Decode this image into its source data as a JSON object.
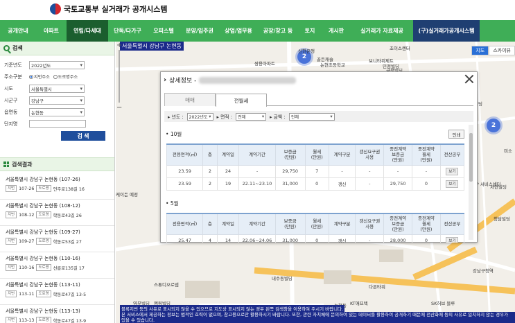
{
  "header": {
    "ministry": "국토교통부",
    "system": "실거래가 공개시스템"
  },
  "nav": [
    {
      "label": "공개안내",
      "width": 52
    },
    {
      "label": "아파트",
      "width": 44
    },
    {
      "label": "연립/다세대",
      "width": 60,
      "active": true
    },
    {
      "label": "단독/다가구",
      "width": 56
    },
    {
      "label": "오피스텔",
      "width": 48
    },
    {
      "label": "분양/입주권",
      "width": 56
    },
    {
      "label": "상업/업무용",
      "width": 56
    },
    {
      "label": "공장/창고 등",
      "width": 58
    },
    {
      "label": "토지",
      "width": 34
    },
    {
      "label": "게시판",
      "width": 42
    },
    {
      "label": "실거래가 자료제공",
      "width": 90
    },
    {
      "label": "(구)실거래가공개시스템",
      "width": 96,
      "dark": true
    }
  ],
  "sidebar": {
    "search_title": "검색",
    "fields": {
      "year_label": "기준년도",
      "year_value": "2022년도",
      "address_label": "주소구분",
      "address_opt1": "지번주소",
      "address_opt2": "도로명주소",
      "sido_label": "시도",
      "sido_value": "서울특별시",
      "sigungu_label": "시군구",
      "sigungu_value": "강남구",
      "dong_label": "읍면동",
      "dong_value": "논현동",
      "complex_label": "단지명",
      "complex_value": ""
    },
    "search_button": "검 색",
    "results_title": "검색결과",
    "results": [
      {
        "title": "서울특별시 강남구 논현동 (107-26)",
        "jibun_tag": "지번",
        "jibun": "107-26",
        "road_tag": "도로명",
        "road": "언주로138길 16"
      },
      {
        "title": "서울특별시 강남구 논현동 (108-12)",
        "jibun_tag": "지번",
        "jibun": "108-12",
        "road_tag": "도로명",
        "road": "학동로43길 26"
      },
      {
        "title": "서울특별시 강남구 논현동 (109-27)",
        "jibun_tag": "지번",
        "jibun": "109-27",
        "road_tag": "도로명",
        "road": "학동로53길 27"
      },
      {
        "title": "서울특별시 강남구 논현동 (110-16)",
        "jibun_tag": "지번",
        "jibun": "110-16",
        "road_tag": "도로명",
        "road": "선릉로135길 17"
      },
      {
        "title": "서울특별시 강남구 논현동 (113-11)",
        "jibun_tag": "지번",
        "jibun": "113-11",
        "road_tag": "도로명",
        "road": "학동로47길 13-5"
      },
      {
        "title": "서울특별시 강남구 논현동 (113-13)",
        "jibun_tag": "지번",
        "jibun": "113-13",
        "road_tag": "도로명",
        "road": "학동로47길 13-9"
      }
    ]
  },
  "map": {
    "region": "서울특별시 강남구 논현동",
    "type_map": "지도",
    "type_sky": "스카이뷰",
    "clusters": [
      "2",
      "2"
    ],
    "notice1": "블록지번 등의 사유로 표시되지 않을 수 있으므로 지도상 표시되지 않는 경우 왼쪽 검색창을 이용하여 주시기 바랍니다.",
    "notice2": "본 서비스에서 제공하는 정보는 법적인 효력이 없으며, 참고용으로만 활용하시기 바랍니다. 또한, 관련 자치체에 문의하여 있는 데이터를 활용하여 공개하기 때문에 전산화에 등의 사유로 일치하지 않는 경우가 있을 수 있습니다.",
    "labels": [
      "신한은행",
      "골든캐슬",
      "논현초등학교",
      "쌍용아파트",
      "초이스렌터",
      "보니타위제트",
      "민정빌딩",
      "금청빌딩",
      "사라빌딩",
      "미소",
      "서현빌딩",
      "HP 서비스센터",
      "청담빌딩",
      "케이든 예정",
      "강남구청역",
      "논현동",
      "다른타워",
      "KT애프텍",
      "SK허브 블루",
      "엠림빌딩",
      "영무빌딩",
      "내수동빌딩",
      "스튜디오로뎀"
    ]
  },
  "modal": {
    "title": "상세정보 -",
    "tabs": [
      "매매",
      "전월세"
    ],
    "active_tab": 1,
    "filters": {
      "year_label": "년도 :",
      "year_value": "2022년도",
      "area_label": "면적 :",
      "area_value": "전체",
      "amount_label": "금액 :",
      "amount_value": "전체"
    },
    "print_label": "인쇄",
    "columns": [
      "전용면적(㎡)",
      "층",
      "계약일",
      "계약기간",
      "보증금\n(만원)",
      "월세\n(만원)",
      "계약구분",
      "갱신요구권\n사용",
      "종전계약\n보증금\n(만원)",
      "종전계약\n월세\n(만원)",
      "전산공부"
    ],
    "view_label": "보기",
    "months": [
      {
        "label": "10월",
        "rows": [
          [
            "23.59",
            "2",
            "24",
            "-",
            "29,750",
            "7",
            "-",
            "-",
            "-",
            "-"
          ],
          [
            "23.59",
            "2",
            "19",
            "22.11~23.10",
            "31,000",
            "0",
            "갱신",
            "-",
            "29,750",
            "0"
          ]
        ]
      },
      {
        "label": "5월",
        "rows": [
          [
            "25.47",
            "4",
            "14",
            "22.06~24.06",
            "31,000",
            "0",
            "갱신",
            "-",
            "28,000",
            "0"
          ]
        ]
      }
    ]
  },
  "colors": {
    "nav_green": "#3fae57",
    "nav_active": "#1b5e2e",
    "nav_dark": "#1f3f72",
    "search_button": "#1f4e9c",
    "cluster": "#4a73d9"
  }
}
